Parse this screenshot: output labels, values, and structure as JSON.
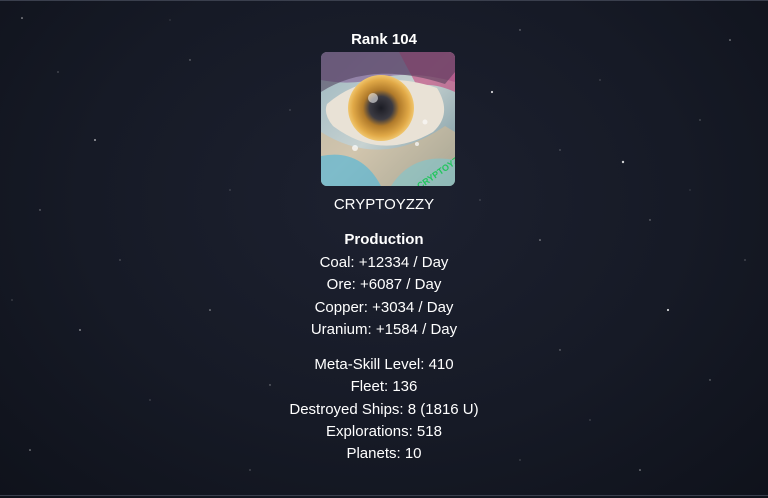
{
  "profile": {
    "rank_label": "Rank 104",
    "username": "CRYPTOYZZY",
    "avatar_caption": "CRYPTOYZZY"
  },
  "production": {
    "title": "Production",
    "items": [
      "Coal: +12334 / Day",
      "Ore: +6087 / Day",
      "Copper: +3034 / Day",
      "Uranium: +1584 / Day"
    ]
  },
  "stats": {
    "items": [
      "Meta-Skill Level: 410",
      "Fleet: 136",
      "Destroyed Ships: 8 (1816 U)",
      "Explorations: 518",
      "Planets: 10"
    ]
  },
  "colors": {
    "background": "#161a26",
    "text": "#ffffff",
    "avatar_accent": "#22c55e"
  }
}
